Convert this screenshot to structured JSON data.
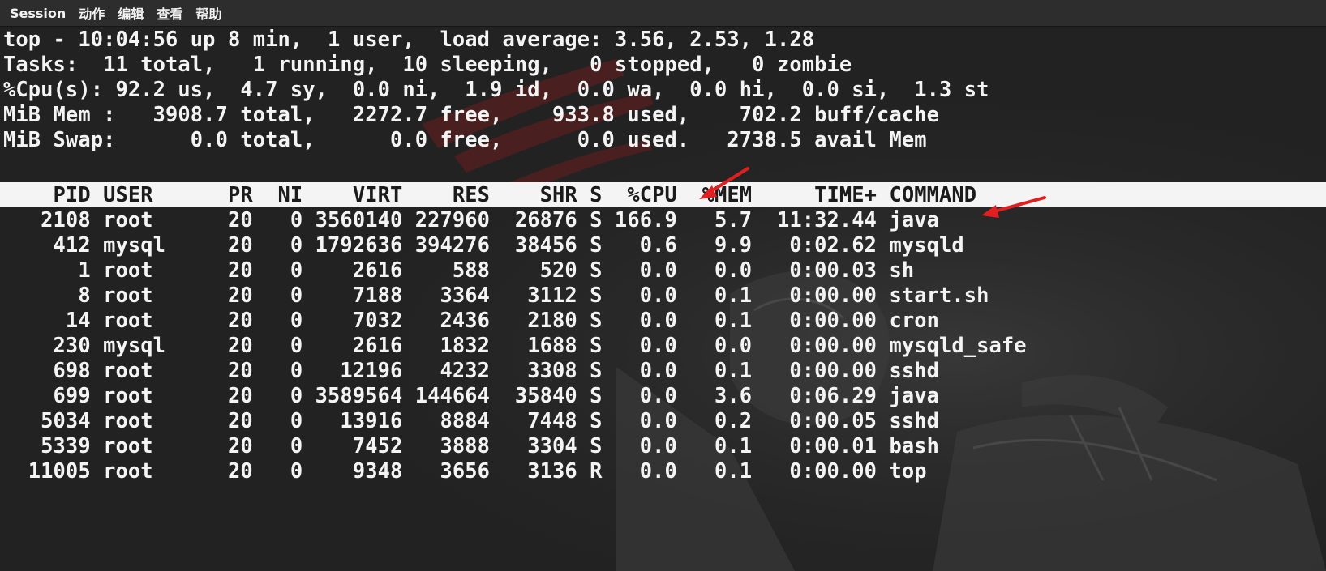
{
  "menubar": {
    "items": [
      "Session",
      "动作",
      "编辑",
      "查看",
      "帮助"
    ]
  },
  "terminal": {
    "summary": [
      "top - 10:04:56 up 8 min,  1 user,  load average: 3.56, 2.53, 1.28",
      "Tasks:  11 total,   1 running,  10 sleeping,   0 stopped,   0 zombie",
      "%Cpu(s): 92.2 us,  4.7 sy,  0.0 ni,  1.9 id,  0.0 wa,  0.0 hi,  0.0 si,  1.3 st",
      "MiB Mem :   3908.7 total,   2272.7 free,    933.8 used,    702.2 buff/cache",
      "MiB Swap:      0.0 total,      0.0 free,      0.0 used.   2738.5 avail Mem"
    ],
    "header": "    PID USER      PR  NI    VIRT    RES    SHR S  %CPU  %MEM     TIME+ COMMAND",
    "rows": [
      "   2108 root      20   0 3560140 227960  26876 S 166.9   5.7  11:32.44 java",
      "    412 mysql     20   0 1792636 394276  38456 S   0.6   9.9   0:02.62 mysqld",
      "      1 root      20   0    2616    588    520 S   0.0   0.0   0:00.03 sh",
      "      8 root      20   0    7188   3364   3112 S   0.0   0.1   0:00.00 start.sh",
      "     14 root      20   0    7032   2436   2180 S   0.0   0.1   0:00.00 cron",
      "    230 mysql     20   0    2616   1832   1688 S   0.0   0.0   0:00.00 mysqld_safe",
      "    698 root      20   0   12196   4232   3308 S   0.0   0.1   0:00.00 sshd",
      "    699 root      20   0 3589564 144664  35840 S   0.0   3.6   0:06.29 java",
      "   5034 root      20   0   13916   8884   7448 S   0.0   0.2   0:00.05 sshd",
      "   5339 root      20   0    7452   3888   3304 S   0.0   0.1   0:00.01 bash",
      "  11005 root      20   0    9348   3656   3136 R   0.0   0.1   0:00.00 top"
    ]
  },
  "annotations": {
    "arrow_color": "#e02020",
    "arrow_icons": [
      "arrow-annotation-cpu-icon",
      "arrow-annotation-java-icon"
    ]
  },
  "colors": {
    "background": "#222222",
    "text": "#f4f4f4",
    "header_band": "#f4f4f4",
    "menubar": "#2d2d2d"
  }
}
